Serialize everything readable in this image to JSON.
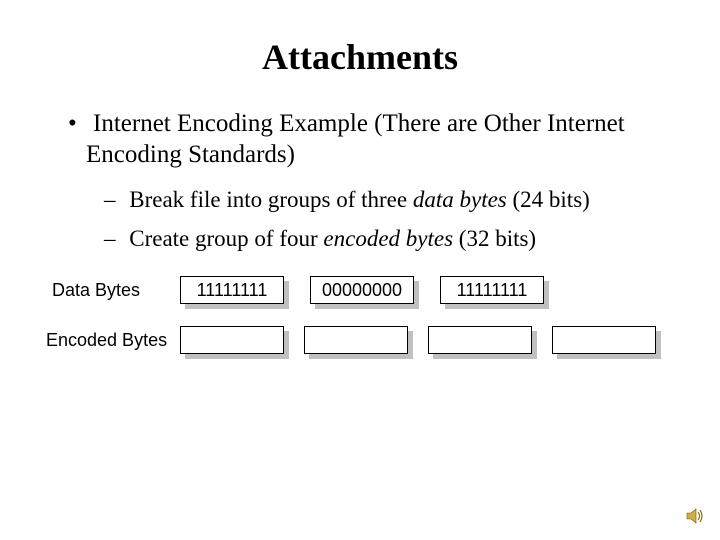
{
  "title": "Attachments",
  "bullets": {
    "l1": "Internet Encoding Example (There are Other Internet Encoding Standards)",
    "l2a_pre": "Break file into groups of three ",
    "l2a_em": "data bytes",
    "l2a_post": " (24 bits)",
    "l2b_pre": "Create group of four ",
    "l2b_em": "encoded bytes",
    "l2b_post": " (32 bits)"
  },
  "labels": {
    "data": "Data Bytes",
    "encoded": "Encoded Bytes"
  },
  "data_bytes": {
    "b0": "11111111",
    "b1": "00000000",
    "b2": "11111111"
  },
  "encoded_bytes": {
    "b0": "",
    "b1": "",
    "b2": "",
    "b3": ""
  }
}
